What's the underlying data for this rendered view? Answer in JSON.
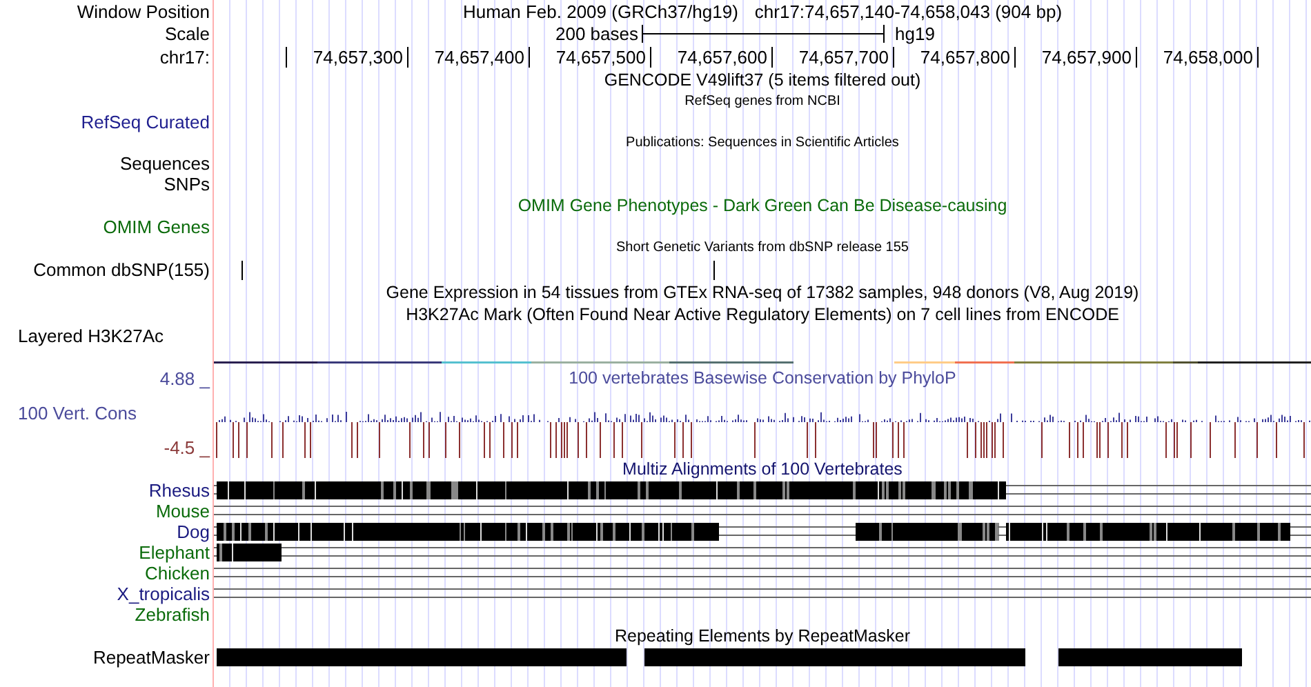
{
  "header": {
    "label": "Window Position",
    "title": "Human Feb. 2009 (GRCh37/hg19)",
    "position": "chr17:74,657,140-74,658,043 (904 bp)"
  },
  "scale": {
    "label": "Scale",
    "text": "200 bases",
    "assembly": "hg19"
  },
  "ruler": {
    "label": "chr17:",
    "ticks": [
      "74,657,300",
      "74,657,400",
      "74,657,500",
      "74,657,600",
      "74,657,700",
      "74,657,800",
      "74,657,900",
      "74,658,000"
    ]
  },
  "rows": [
    {
      "kind": "title",
      "text": "GENCODE V49lift37 (5 items filtered out)",
      "color": "#000000"
    },
    {
      "kind": "note",
      "text": "RefSeq genes from NCBI"
    },
    {
      "kind": "label",
      "label": "RefSeq Curated",
      "color": "#1f1f8f"
    },
    {
      "kind": "note",
      "text": "Publications: Sequences in Scientific Articles"
    },
    {
      "kind": "label",
      "label": "Sequences",
      "color": "#000000"
    },
    {
      "kind": "label",
      "label": "SNPs",
      "color": "#000000"
    },
    {
      "kind": "title",
      "text": "OMIM Gene Phenotypes - Dark Green Can Be Disease-causing",
      "color": "#0b6b0b"
    },
    {
      "kind": "label",
      "label": "OMIM Genes",
      "color": "#0b6b0b"
    },
    {
      "kind": "note",
      "text": "Short Genetic Variants from dbSNP release 155"
    },
    {
      "kind": "snp",
      "label": "Common dbSNP(155)"
    },
    {
      "kind": "title",
      "text": "Gene Expression in 54 tissues from GTEx RNA-seq of 17382 samples, 948 donors (V8, Aug 2019)",
      "color": "#000000"
    },
    {
      "kind": "title",
      "text": "H3K27Ac Mark (Often Found Near Active Regulatory Elements) on 7 cell lines from ENCODE",
      "color": "#000000"
    },
    {
      "kind": "composite",
      "label": "Layered H3K27Ac"
    },
    {
      "kind": "conservation",
      "label": "100 Vert. Cons",
      "max": "4.88 _",
      "min": "-4.5 _",
      "text": "100 vertebrates Basewise Conservation by PhyloP"
    },
    {
      "kind": "title",
      "text": "Multiz Alignments of 100 Vertebrates",
      "color": "#14146e"
    },
    {
      "kind": "species",
      "label": "Rhesus",
      "color": "#1a1a80"
    },
    {
      "kind": "species",
      "label": "Mouse",
      "color": "#0b6b0b"
    },
    {
      "kind": "species",
      "label": "Dog",
      "color": "#1a1a80"
    },
    {
      "kind": "species",
      "label": "Elephant",
      "color": "#0b6b0b"
    },
    {
      "kind": "species",
      "label": "Chicken",
      "color": "#0b6b0b"
    },
    {
      "kind": "species",
      "label": "X_tropicalis",
      "color": "#1a1a80"
    },
    {
      "kind": "species",
      "label": "Zebrafish",
      "color": "#0b6b0b"
    },
    {
      "kind": "title",
      "text": "Repeating Elements by RepeatMasker",
      "color": "#000000"
    },
    {
      "kind": "repeat",
      "label": "RepeatMasker"
    }
  ]
}
